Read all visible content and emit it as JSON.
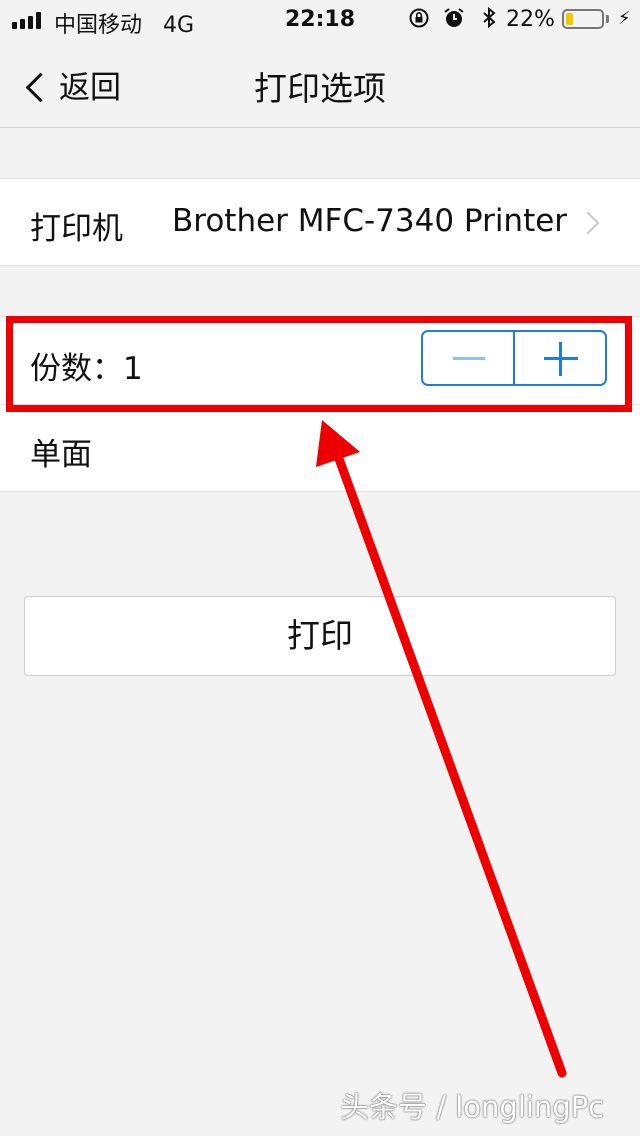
{
  "status_bar": {
    "carrier": "中国移动",
    "network": "4G",
    "time": "22:18",
    "icons": [
      "rotation-lock-icon",
      "alarm-icon",
      "bluetooth-icon"
    ],
    "battery_percent_text": "22%",
    "battery_level": 0.22,
    "battery_color": "#f2c600"
  },
  "navbar": {
    "back_label": "返回",
    "title": "打印选项"
  },
  "printer": {
    "label": "打印机",
    "value": "Brother MFC-7340 Printer"
  },
  "copies": {
    "label": "份数：1"
  },
  "duplex": {
    "label": "单面"
  },
  "print_button": {
    "label": "打印"
  },
  "annotation": {
    "color": "#ee0000"
  },
  "watermark": "头条号 / longlingPc",
  "accent_color": "#1f7ce0"
}
